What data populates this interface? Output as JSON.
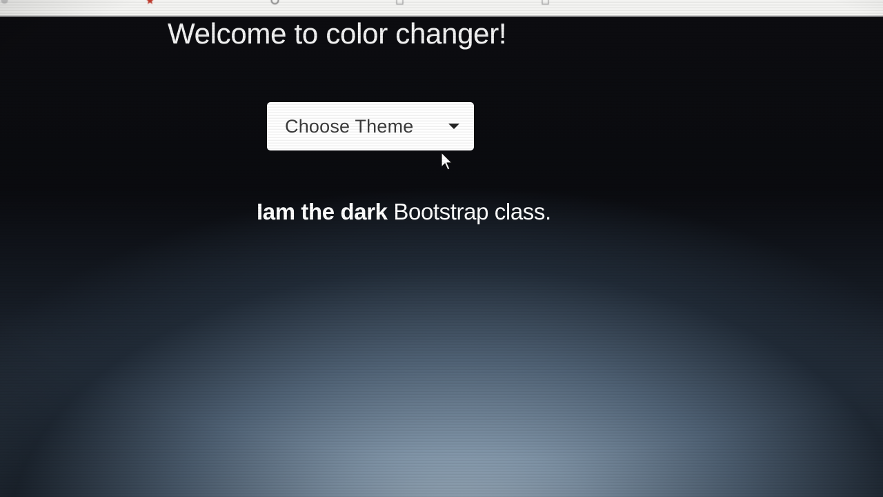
{
  "page": {
    "title": "Welcome to color changer!",
    "dropdown": {
      "label": "Choose Theme"
    },
    "message": {
      "part1": "Iam the ",
      "part2": "dark",
      "part3": " Bootstrap class."
    }
  },
  "colors": {
    "background_top": "#0a0b0f",
    "background_glow": "#a8bac9",
    "text": "#f2f2f2",
    "dropdown_bg": "#ffffff",
    "dropdown_text": "#3b3b3b"
  },
  "icons": {
    "dropdown_caret": "caret-down-icon",
    "cursor": "mouse-pointer-icon"
  }
}
